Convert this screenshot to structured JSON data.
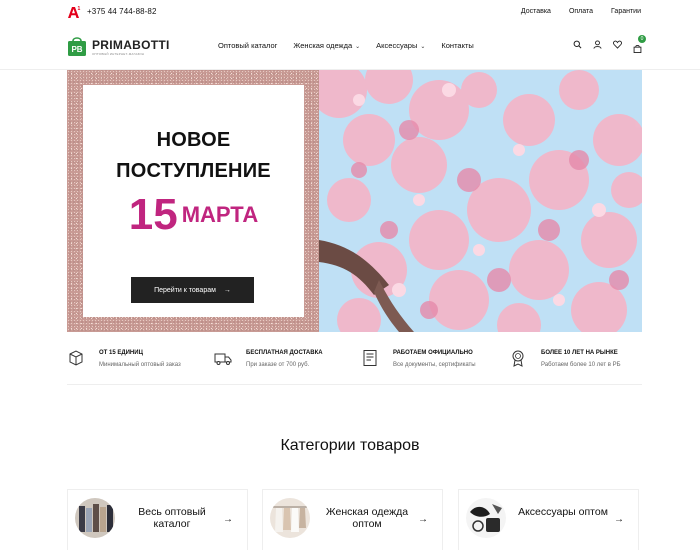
{
  "topbar": {
    "phone": "+375 44 744-88-82",
    "links": [
      "Доставка",
      "Оплата",
      "Гарантии"
    ]
  },
  "header": {
    "brand": "PRIMABOTTI",
    "brand_tagline": "ОПТОВЫЙ ИНТЕРНЕТ-МАГАЗИН",
    "logo_letters": "PB",
    "nav": [
      {
        "label": "Оптовый каталог",
        "dropdown": false
      },
      {
        "label": "Женская одежда",
        "dropdown": true
      },
      {
        "label": "Аксессуары",
        "dropdown": true
      },
      {
        "label": "Контакты",
        "dropdown": false
      }
    ],
    "icons": [
      "search-icon",
      "user-icon",
      "heart-icon",
      "cart-icon"
    ],
    "cart_count": "0",
    "accent_color": "#2f9c44"
  },
  "hero": {
    "line1": "НОВОЕ",
    "line2": "ПОСТУПЛЕНИЕ",
    "date_number": "15",
    "date_month": "МАРТА",
    "date_color": "#c0257f",
    "button_label": "Перейти к товарам",
    "button_arrow": "→"
  },
  "features": [
    {
      "icon": "box-icon",
      "title": "ОТ 15 ЕДИНИЦ",
      "desc": "Минимальный оптовый заказ"
    },
    {
      "icon": "truck-icon",
      "title": "БЕСПЛАТНАЯ ДОСТАВКА",
      "desc": "При заказе от 700 руб."
    },
    {
      "icon": "document-icon",
      "title": "РАБОТАЕМ ОФИЦИАЛЬНО",
      "desc": "Все документы, сертификаты"
    },
    {
      "icon": "award-icon",
      "title": "БОЛЕЕ 10 ЛЕТ НА РЫНКЕ",
      "desc": "Работаем более 10 лет в РБ"
    }
  ],
  "categories": {
    "heading": "Категории товаров",
    "items": [
      {
        "name": "Весь оптовый каталог",
        "arrow": "→"
      },
      {
        "name": "Женская одежда оптом",
        "arrow": "→"
      },
      {
        "name": "Аксессуары оптом",
        "arrow": "→"
      }
    ]
  }
}
